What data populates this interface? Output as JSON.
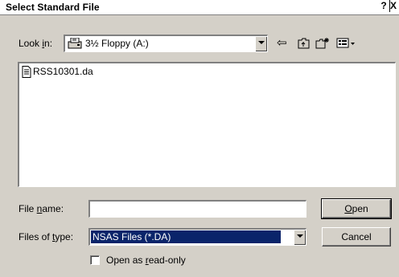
{
  "window": {
    "title": "Select Standard File",
    "help_label": "?",
    "close_label": "X"
  },
  "lookin": {
    "label_pre": "Look ",
    "label_key": "i",
    "label_post": "n:",
    "value": "3½ Floppy (A:)",
    "icon": "floppy-drive-icon"
  },
  "toolbar": {
    "back_icon": "⇦",
    "up_icon": "⮤",
    "newfolder_icon": "✱",
    "views_icon": "▤"
  },
  "files": [
    {
      "name": "RSS10301.da",
      "icon": "document-icon"
    }
  ],
  "filename": {
    "label_pre": "File ",
    "label_key": "n",
    "label_post": "ame:",
    "value": ""
  },
  "filetype": {
    "label_pre": "Files of ",
    "label_key": "t",
    "label_post": "ype:",
    "value": "NSAS Files (*.DA)"
  },
  "buttons": {
    "open_key": "O",
    "open_rest": "pen",
    "cancel": "Cancel"
  },
  "readonly": {
    "label_pre": "Open as ",
    "label_key": "r",
    "label_post": "ead-only",
    "checked": false
  }
}
